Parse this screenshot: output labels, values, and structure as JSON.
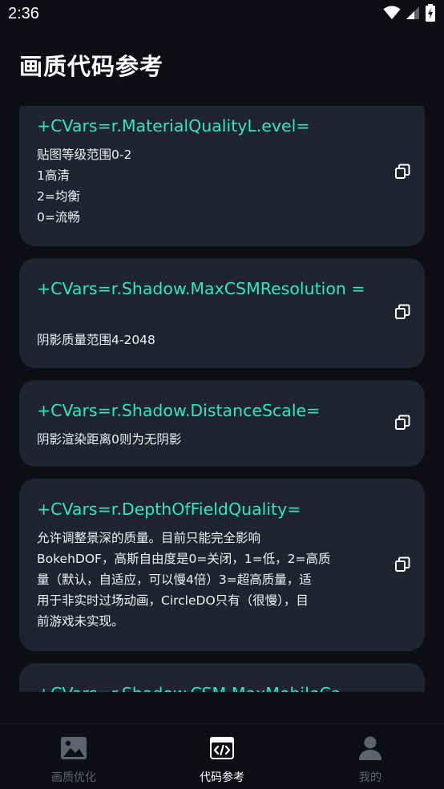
{
  "status_bar": {
    "time": "2:36"
  },
  "page": {
    "title": "画质代码参考"
  },
  "colors": {
    "background": "#0d0f14",
    "card": "#1f2430",
    "accent": "#2ee8c1",
    "nav_active": "#ffffff",
    "nav_inactive": "#5f636c"
  },
  "cards": [
    {
      "code_lines": [
        "+CVars=r.MaterialQualityL.evel="
      ],
      "desc_lines": [
        "贴图等级范围0-2",
        "1高清",
        "2=均衡",
        "0=流畅"
      ],
      "copy_icon": "copy-icon"
    },
    {
      "code_lines": [
        "+CVars=r.Shadow.MaxCSMResolution",
        "="
      ],
      "desc_lines": [
        "阴影质量范围4-2048"
      ],
      "copy_icon": "copy-icon"
    },
    {
      "code_lines": [
        "+CVars=r.Shadow.DistanceScale="
      ],
      "desc_lines": [
        "阴影渲染距离0则为无阴影"
      ],
      "copy_icon": "copy-icon"
    },
    {
      "code_lines": [
        "+CVars=r.DepthOfFieldQuality="
      ],
      "desc_lines": [
        "允许调整景深的质量。目前只能完全影响",
        "BokehDOF，高斯自由度是0=关闭，1=低，2=高质",
        "量（默认，自适应，可以慢4倍）3=超高质量，适",
        "用于非实时过场动画，CircleDO只有（很慢），目",
        "前游戏未实现。"
      ],
      "copy_icon": "copy-icon"
    },
    {
      "code_lines": [
        "+CVars=r.Shadow.CSM.MaxMobileCa"
      ],
      "desc_lines": [],
      "copy_icon": "copy-icon"
    }
  ],
  "bottom_nav": {
    "items": [
      {
        "label": "画质优化",
        "icon": "image-icon",
        "active": false
      },
      {
        "label": "代码参考",
        "icon": "code-icon",
        "active": true
      },
      {
        "label": "我的",
        "icon": "person-icon",
        "active": false
      }
    ]
  }
}
